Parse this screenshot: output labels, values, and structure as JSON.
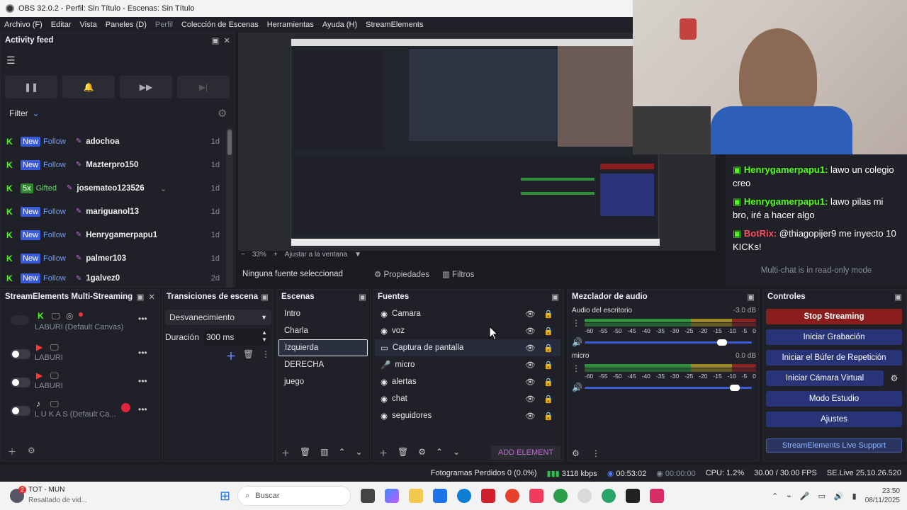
{
  "window": {
    "title": "OBS 32.0.2 - Perfil: Sin Título - Escenas: Sin Título"
  },
  "menu": [
    "Archivo (F)",
    "Editar",
    "Vista",
    "Paneles (D)",
    "Perfil",
    "Colección de Escenas",
    "Herramientas",
    "Ayuda (H)",
    "StreamElements"
  ],
  "activity": {
    "title": "Activity feed",
    "filter_label": "Filter",
    "items": [
      {
        "tag": "New",
        "kind": "Follow",
        "name": "adochoa",
        "time": "1d"
      },
      {
        "tag": "New",
        "kind": "Follow",
        "name": "Mazterpro150",
        "time": "1d"
      },
      {
        "tag": "5x",
        "kind": "Gifted",
        "name": "josemateo123526",
        "time": "1d"
      },
      {
        "tag": "New",
        "kind": "Follow",
        "name": "mariguanol13",
        "time": "1d"
      },
      {
        "tag": "New",
        "kind": "Follow",
        "name": "Henrygamerpapu1",
        "time": "1d"
      },
      {
        "tag": "New",
        "kind": "Follow",
        "name": "palmer103",
        "time": "1d"
      },
      {
        "tag": "New",
        "kind": "Follow",
        "name": "1galvez0",
        "time": "2d"
      }
    ]
  },
  "preview": {
    "zoom": "33%",
    "fit_label": "Ajustar a la ventana"
  },
  "source_bar": {
    "none_selected": "Ninguna fuente seleccionad",
    "properties": "Propiedades",
    "filters": "Filtros"
  },
  "chat": {
    "lines": [
      {
        "user": "Henrygamerpapu1:",
        "msg": "lawo un colegio creo"
      },
      {
        "user": "Henrygamerpapu1:",
        "msg": "lawo pilas mi bro, iré a hacer algo"
      },
      {
        "user": "BotRix:",
        "msg": "@thiagopijer9 me inyecto 10 KICKs!"
      }
    ],
    "readonly": "Multi-chat is in read-only mode"
  },
  "multistream": {
    "title": "StreamElements Multi-Streaming",
    "rows": [
      {
        "label": "LABURI (Default Canvas)"
      },
      {
        "label": "LABURI"
      },
      {
        "label": "LABURI"
      },
      {
        "label": "L U K A S (Default Ca..."
      }
    ]
  },
  "transitions": {
    "title": "Transiciones de escena",
    "selected": "Desvanecimiento",
    "duration_label": "Duración",
    "duration_value": "300 ms"
  },
  "scenes": {
    "title": "Escenas",
    "items": [
      "Intro",
      "Charla",
      "Izquierda",
      "DERECHA",
      "juego"
    ],
    "selected_index": 2
  },
  "sources": {
    "title": "Fuentes",
    "items": [
      "Camara",
      "voz",
      "Captura de pantalla",
      "micro",
      "alertas",
      "chat",
      "seguidores"
    ],
    "selected_index": 2,
    "add_label": "ADD ELEMENT"
  },
  "mixer": {
    "title": "Mezclador de audio",
    "channels": [
      {
        "name": "Audio del escritorio",
        "db": "-3.0 dB",
        "level": 0.85
      },
      {
        "name": "micro",
        "db": "0.0 dB",
        "level": 0.93
      }
    ],
    "ticks": [
      "-60",
      "-55",
      "-50",
      "-45",
      "-40",
      "-35",
      "-30",
      "-25",
      "-20",
      "-15",
      "-10",
      "-5",
      "0"
    ]
  },
  "controls": {
    "title": "Controles",
    "stop": "Stop Streaming",
    "record": "Iniciar Grabación",
    "replay": "Iniciar el Búfer de Repetición",
    "vcam": "Iniciar Cámara Virtual",
    "studio": "Modo Estudio",
    "settings": "Ajustes",
    "support": "StreamElements Live Support"
  },
  "status": {
    "dropped": "Fotogramas Perdidos 0 (0.0%)",
    "bitrate": "3118 kbps",
    "stream_time": "00:53:02",
    "rec_time": "00:00:00",
    "cpu": "CPU: 1.2%",
    "fps": "30.00 / 30.00 FPS",
    "se": "SE.Live 25.10.26.520"
  },
  "taskbar": {
    "notif_app": "TOT - MUN",
    "notif_sub": "Resaltado de vid...",
    "notif_badge": "2",
    "search": "Buscar",
    "time": "23:50",
    "date": "08/11/2025"
  },
  "colors": {
    "accent_blue": "#283378",
    "stop_red": "#8a1e1e",
    "kick_green": "#53fc18"
  }
}
